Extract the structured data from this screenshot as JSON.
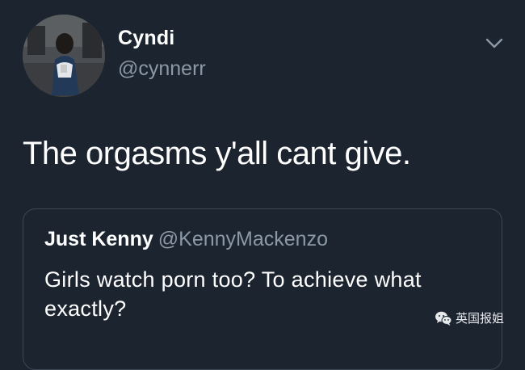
{
  "tweet": {
    "author_name": "Cyndi",
    "author_handle": "@cynnerr",
    "text": "The orgasms y'all cant give."
  },
  "quoted_tweet": {
    "author_name": "Just Kenny",
    "author_handle": "@KennyMackenzo",
    "text": "Girls watch porn too? To achieve what exactly?"
  },
  "watermark": {
    "text": "英国报姐"
  },
  "icons": {
    "menu": "chevron-down-icon",
    "watermark": "wechat-icon",
    "avatar": "avatar-photo"
  },
  "colors": {
    "background": "#1c2430",
    "primary_text": "#ffffff",
    "secondary_text": "#8b98a5",
    "card_border": "#3d4753"
  }
}
